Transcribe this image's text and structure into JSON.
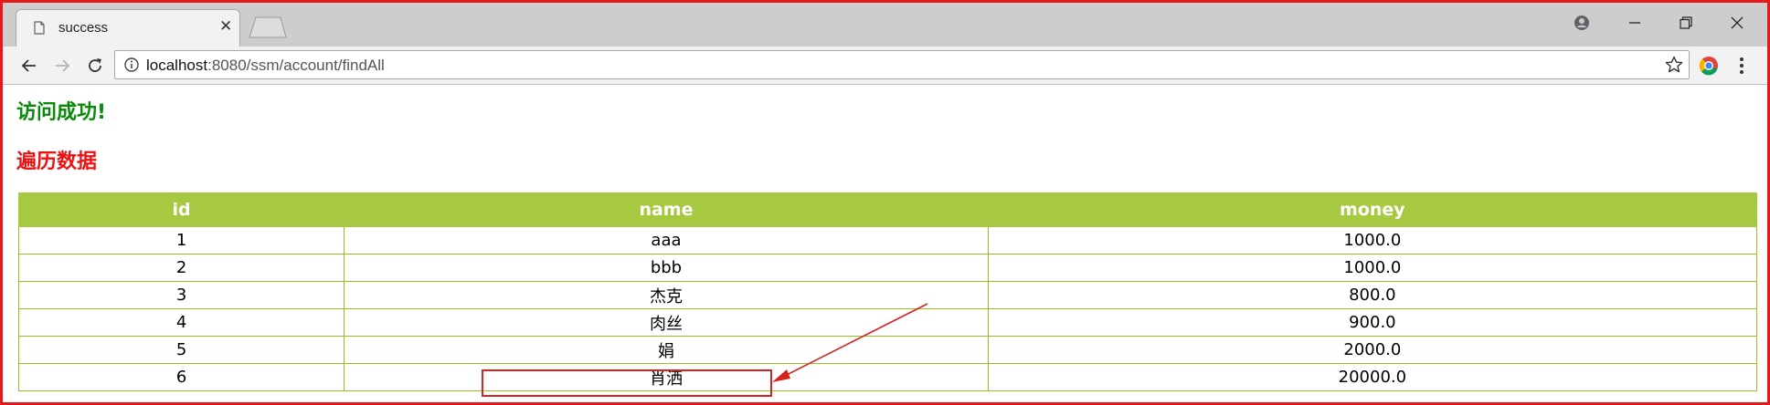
{
  "browser": {
    "tab": {
      "title": "success",
      "close_glyph": "✕",
      "favicon": "page-icon"
    },
    "address_bar": {
      "url_host": "localhost",
      "url_rest": ":8080/ssm/account/findAll"
    },
    "icons": {
      "back": "back-arrow-icon",
      "forward": "forward-arrow-icon",
      "reload": "reload-icon",
      "info": "info-icon",
      "bookmark": "star-icon",
      "extension": "chrome-extension-icon",
      "menu": "kebab-menu-icon",
      "profile": "profile-icon",
      "minimize": "minimize-icon",
      "restore": "restore-icon",
      "close": "close-icon"
    }
  },
  "page": {
    "success_message": "访问成功!",
    "list_heading": "遍历数据",
    "table": {
      "headers": [
        "id",
        "name",
        "money"
      ],
      "rows": [
        [
          "1",
          "aaa",
          "1000.0"
        ],
        [
          "2",
          "bbb",
          "1000.0"
        ],
        [
          "3",
          "杰克",
          "800.0"
        ],
        [
          "4",
          "肉丝",
          "900.0"
        ],
        [
          "5",
          "娟",
          "2000.0"
        ],
        [
          "6",
          "肖洒",
          "20000.0"
        ]
      ]
    }
  },
  "colors": {
    "header_bg": "#a7c942",
    "row_border": "#98bf21",
    "success_text": "#0a8a0a",
    "heading_text": "#ee1111",
    "annotation": "#d6231f"
  }
}
